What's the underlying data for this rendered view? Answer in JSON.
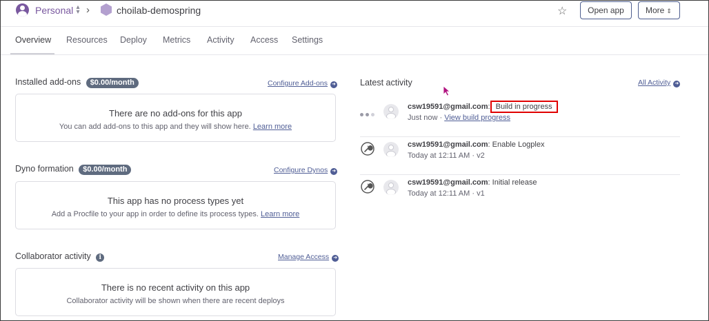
{
  "header": {
    "account_name": "Personal",
    "app_name": "choilab-demospring",
    "open_app_label": "Open app",
    "more_label": "More"
  },
  "tabs": [
    {
      "label": "Overview",
      "active": true
    },
    {
      "label": "Resources"
    },
    {
      "label": "Deploy"
    },
    {
      "label": "Metrics"
    },
    {
      "label": "Activity"
    },
    {
      "label": "Access"
    },
    {
      "label": "Settings"
    }
  ],
  "addons": {
    "title": "Installed add-ons",
    "price": "$0.00/month",
    "link": "Configure Add-ons",
    "empty_title": "There are no add-ons for this app",
    "empty_sub": "You can add add-ons to this app and they will show here.",
    "learn_more": "Learn more"
  },
  "dynos": {
    "title": "Dyno formation",
    "price": "$0.00/month",
    "link": "Configure Dynos",
    "empty_title": "This app has no process types yet",
    "empty_sub": "Add a Procfile to your app in order to define its process types.",
    "learn_more": "Learn more"
  },
  "collaborators": {
    "title": "Collaborator activity",
    "link": "Manage Access",
    "empty_title": "There is no recent activity on this app",
    "empty_sub": "Collaborator activity will be shown when there are recent deploys"
  },
  "activity": {
    "title": "Latest activity",
    "all_link": "All Activity",
    "items": [
      {
        "icon": "building-dots-icon",
        "email": "csw19591@gmail.com",
        "sep": ":",
        "action": "Build in progress",
        "time": "Just now",
        "meta_sep": " · ",
        "link": "View build progress"
      },
      {
        "icon": "wrench-icon",
        "email": "csw19591@gmail.com",
        "sep": ":",
        "action": "Enable Logplex",
        "time": "Today at 12:11 AM",
        "meta_sep": " · ",
        "version": "v2"
      },
      {
        "icon": "wrench-icon",
        "email": "csw19591@gmail.com",
        "sep": ":",
        "action": "Initial release",
        "time": "Today at 12:11 AM",
        "meta_sep": " · ",
        "version": "v1"
      }
    ]
  },
  "colors": {
    "accent": "#79589f",
    "link": "#4f5d95",
    "badge": "#5f6b7f",
    "highlight": "#e00000",
    "cursor": "#b0117f"
  }
}
